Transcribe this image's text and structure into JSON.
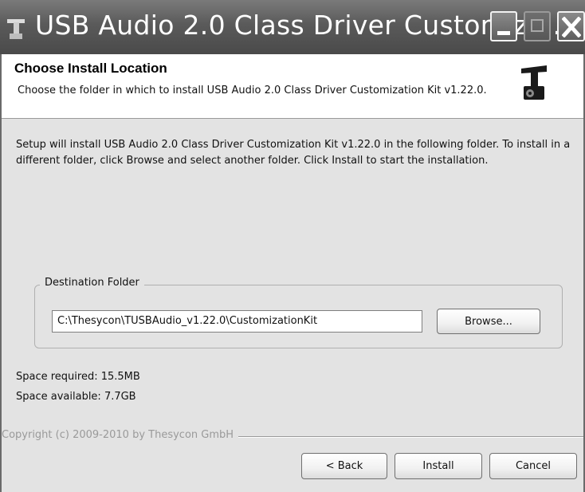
{
  "window": {
    "title": "USB Audio 2.0 Class Driver Customiza...",
    "icon": "thesycon-logo-icon"
  },
  "header": {
    "title": "Choose Install Location",
    "subtitle": "Choose the folder in which to install USB Audio 2.0 Class Driver Customization Kit v1.22.0."
  },
  "body": {
    "instructions": "Setup will install USB Audio 2.0 Class Driver Customization Kit v1.22.0 in the following folder. To install in a different folder, click Browse and select another folder. Click Install to start the installation."
  },
  "destination": {
    "group_label": "Destination Folder",
    "path": "C:\\Thesycon\\TUSBAudio_v1.22.0\\CustomizationKit",
    "browse_label": "Browse..."
  },
  "space": {
    "required": "Space required: 15.5MB",
    "available": "Space available: 7.7GB"
  },
  "footer": {
    "copyright": "Copyright (c) 2009-2010 by Thesycon GmbH",
    "back_label": "< Back",
    "install_label": "Install",
    "cancel_label": "Cancel"
  }
}
